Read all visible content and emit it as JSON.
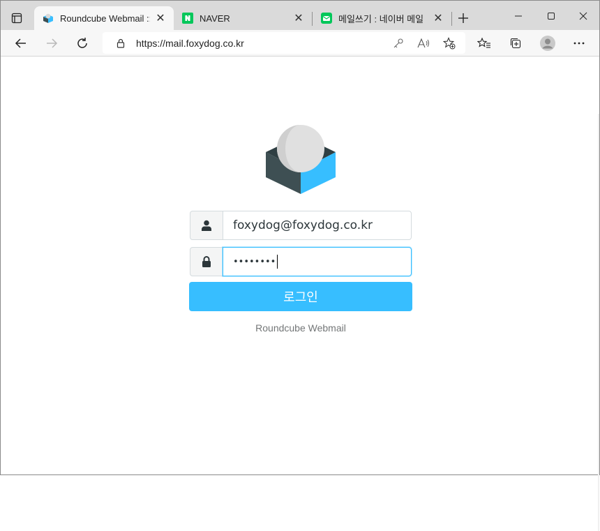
{
  "browser": {
    "tabs": [
      {
        "title": "Roundcube Webmail :: Roundcube Webmail",
        "icon": "roundcube-favicon-icon",
        "active": true
      },
      {
        "title": "NAVER",
        "icon": "naver-favicon-icon",
        "active": false
      },
      {
        "title": "메일쓰기 : 네이버 메일",
        "icon": "naver-mail-favicon-icon",
        "active": false
      }
    ],
    "url": "https://mail.foxydog.co.kr"
  },
  "colors": {
    "accent": "#37beff",
    "logo_dark": "#3e4f53",
    "logo_light": "#37beff",
    "logo_sphere": "#e0e0e0"
  },
  "login": {
    "username": "foxydog@foxydog.co.kr",
    "password_mask": "••••••••",
    "submit_label": "로그인",
    "product_name": "Roundcube Webmail"
  }
}
